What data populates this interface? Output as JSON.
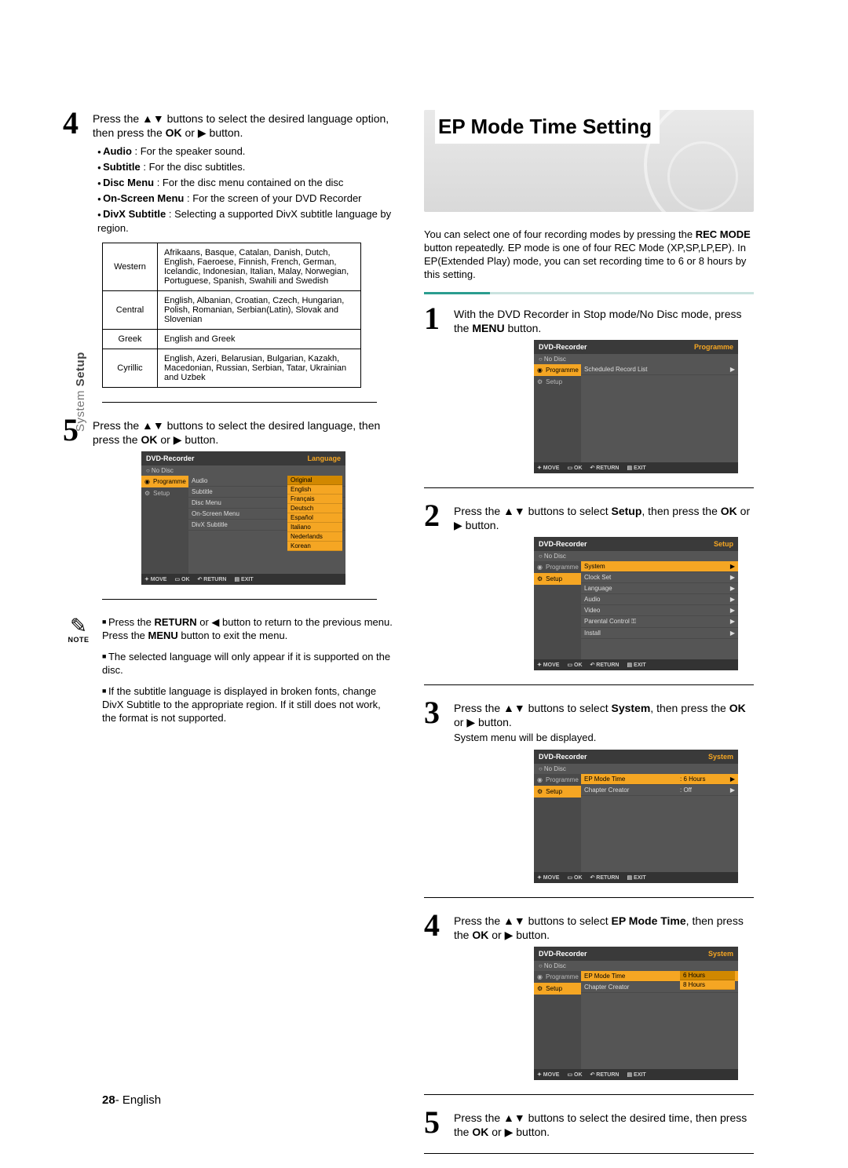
{
  "tabLabel": {
    "light": "System ",
    "bold": "Setup"
  },
  "left": {
    "step4": {
      "num": "4",
      "text_pre": "Press the ",
      "arrows": "▲▼",
      "text_mid": " buttons to select the desired language option, then press the ",
      "ok": "OK",
      "text_or": " or ",
      "play": "▶",
      "text_end": " button."
    },
    "bullets": [
      {
        "b": "Audio",
        "t": " : For the speaker sound."
      },
      {
        "b": "Subtitle",
        "t": " : For the disc subtitles."
      },
      {
        "b": "Disc Menu",
        "t": " : For the disc menu contained on the disc"
      },
      {
        "b": "On-Screen Menu",
        "t": " : For the screen of your DVD Recorder"
      },
      {
        "b": "DivX Subtitle",
        "t": " : Selecting a supported DivX subtitle language by region."
      }
    ],
    "langTable": [
      {
        "region": "Western",
        "langs": "Afrikaans, Basque, Catalan, Danish, Dutch, English, Faeroese, Finnish, French, German, Icelandic, Indonesian, Italian, Malay, Norwegian, Portuguese, Spanish, Swahili and Swedish"
      },
      {
        "region": "Central",
        "langs": "English, Albanian, Croatian, Czech, Hungarian, Polish, Romanian, Serbian(Latin), Slovak and Slovenian"
      },
      {
        "region": "Greek",
        "langs": "English and Greek"
      },
      {
        "region": "Cyrillic",
        "langs": "English, Azeri, Belarusian, Bulgarian, Kazakh, Macedonian, Russian, Serbian, Tatar, Ukrainian and Uzbek"
      }
    ],
    "step5": {
      "num": "5",
      "text_pre": "Press the ",
      "arrows": "▲▼",
      "text_mid": " buttons to select the desired language, then press the ",
      "ok": "OK",
      "text_or": " or ",
      "play": "▶",
      "text_end": " button."
    },
    "osdLang": {
      "title": "DVD-Recorder",
      "section": "Language",
      "noDisc": "No Disc",
      "side": [
        {
          "label": "Programme",
          "sel": true,
          "icon": "disc"
        },
        {
          "label": "Setup",
          "sel": false,
          "icon": "gear"
        }
      ],
      "rows": [
        "Audio",
        "Subtitle",
        "Disc Menu",
        "On-Screen Menu",
        "DivX Subtitle"
      ],
      "popup": [
        "Original",
        "English",
        "Français",
        "Deutsch",
        "Español",
        "Italiano",
        "Nederlands",
        "Korean"
      ],
      "ftr": [
        "✦ MOVE",
        "▭ OK",
        "↶ RETURN",
        "▤ EXIT"
      ]
    },
    "note": {
      "icon": "✎",
      "label": "NOTE",
      "items": [
        {
          "pre": "Press the ",
          "b1": "RETURN",
          "mid": " or ◀ button to return to the previous menu.\nPress the ",
          "b2": "MENU",
          "end": " button to exit the menu."
        },
        {
          "t": "The selected language will only appear if it is supported on the disc."
        },
        {
          "t": "If the subtitle language is displayed in broken fonts, change DivX Subtitle to the appropriate region.\nIf it still does not work, the format is not supported."
        }
      ]
    }
  },
  "right": {
    "bannerTitle": "EP Mode Time Setting",
    "intro_pre": "You can select one of four recording modes by pressing the ",
    "intro_b": "REC MODE",
    "intro_post": " button repeatedly. EP mode is one of four REC Mode (XP,SP,LP,EP). In EP(Extended Play) mode, you can set recording time to 6 or 8 hours by this setting.",
    "steps": [
      {
        "num": "1",
        "html": [
          "With the DVD Recorder in Stop mode/No Disc mode, press the ",
          " button."
        ],
        "bold": [
          "MENU"
        ],
        "sub": ""
      },
      {
        "num": "2",
        "html": [
          "Press the ▲▼ buttons to select ",
          ", then press the ",
          " or ▶ button."
        ],
        "bold": [
          "Setup",
          "OK"
        ],
        "sub": ""
      },
      {
        "num": "3",
        "html": [
          "Press the ▲▼ buttons to select ",
          ", then press the ",
          " or ▶ button."
        ],
        "bold": [
          "System",
          "OK"
        ],
        "sub": "System menu will be displayed."
      },
      {
        "num": "4",
        "html": [
          "Press the ▲▼ buttons to select ",
          ", then press the ",
          " or ▶ button."
        ],
        "bold": [
          "EP Mode Time",
          "OK"
        ],
        "sub": ""
      },
      {
        "num": "5",
        "html": [
          "Press the ▲▼ buttons to select the desired time, then press the ",
          " or ▶ button."
        ],
        "bold": [
          "OK"
        ],
        "sub": ""
      }
    ],
    "osd1": {
      "title": "DVD-Recorder",
      "section": "Programme",
      "noDisc": "No Disc",
      "side": [
        {
          "label": "Programme",
          "sel": true,
          "icon": "disc"
        },
        {
          "label": "Setup",
          "sel": false,
          "icon": "gear"
        }
      ],
      "rows": [
        {
          "lab": "Scheduled Record List",
          "val": "",
          "arr": "▶"
        }
      ],
      "ftr": [
        "✦ MOVE",
        "▭ OK",
        "↶ RETURN",
        "▤ EXIT"
      ]
    },
    "osd2": {
      "title": "DVD-Recorder",
      "section": "Setup",
      "noDisc": "No Disc",
      "side": [
        {
          "label": "Programme",
          "sel": false,
          "icon": "disc"
        },
        {
          "label": "Setup",
          "sel": true,
          "icon": "gear"
        }
      ],
      "rows": [
        {
          "lab": "System",
          "val": "",
          "arr": "▶",
          "sel": true
        },
        {
          "lab": "Clock Set",
          "val": "",
          "arr": "▶"
        },
        {
          "lab": "Language",
          "val": "",
          "arr": "▶"
        },
        {
          "lab": "Audio",
          "val": "",
          "arr": "▶"
        },
        {
          "lab": "Video",
          "val": "",
          "arr": "▶"
        },
        {
          "lab": "Parental Control ⚿",
          "val": "",
          "arr": "▶"
        },
        {
          "lab": "Install",
          "val": "",
          "arr": "▶"
        }
      ],
      "ftr": [
        "✦ MOVE",
        "▭ OK",
        "↶ RETURN",
        "▤ EXIT"
      ]
    },
    "osd3": {
      "title": "DVD-Recorder",
      "section": "System",
      "noDisc": "No Disc",
      "side": [
        {
          "label": "Programme",
          "sel": false,
          "icon": "disc"
        },
        {
          "label": "Setup",
          "sel": true,
          "icon": "gear"
        }
      ],
      "rows": [
        {
          "lab": "EP Mode Time",
          "val": ": 6 Hours",
          "arr": "▶",
          "sel": true
        },
        {
          "lab": "Chapter Creator",
          "val": ": Off",
          "arr": "▶"
        }
      ],
      "ftr": [
        "✦ MOVE",
        "▭ OK",
        "↶ RETURN",
        "▤ EXIT"
      ]
    },
    "osd4": {
      "title": "DVD-Recorder",
      "section": "System",
      "noDisc": "No Disc",
      "side": [
        {
          "label": "Programme",
          "sel": false,
          "icon": "disc"
        },
        {
          "label": "Setup",
          "sel": true,
          "icon": "gear"
        }
      ],
      "rows": [
        {
          "lab": "EP Mode Time",
          "val": "",
          "arr": "",
          "sel": true
        },
        {
          "lab": "Chapter Creator",
          "val": "",
          "arr": ""
        }
      ],
      "popup": [
        "6 Hours",
        "8 Hours"
      ],
      "ftr": [
        "✦ MOVE",
        "▭ OK",
        "↶ RETURN",
        "▤ EXIT"
      ]
    }
  },
  "footer": {
    "page": "28",
    "dash": "- ",
    "lang": "English"
  }
}
